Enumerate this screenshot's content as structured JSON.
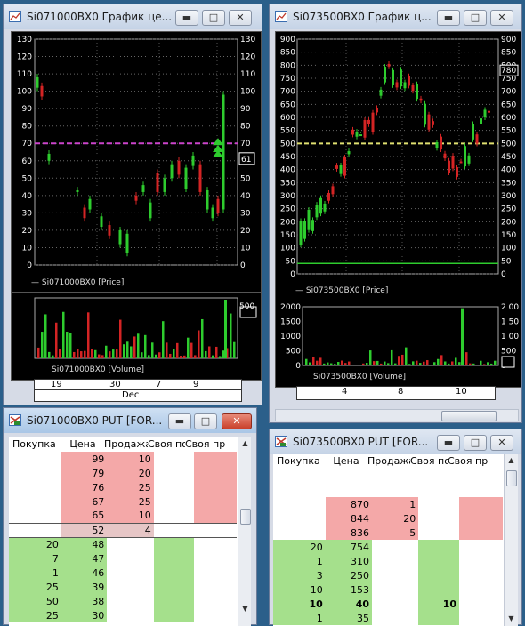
{
  "win1": {
    "title": "Si071000BX0 График це...",
    "price_chart": {
      "yticks": [
        "130",
        "120",
        "110",
        "100",
        "90",
        "80",
        "70",
        "60",
        "50",
        "40",
        "30",
        "20",
        "10",
        "0"
      ],
      "ymin": 0,
      "ymax": 130,
      "level_line": 70,
      "current_label": "61",
      "legend": "Si071000BX0 [Price]"
    },
    "volume_chart": {
      "right_tick": "500",
      "legend": "Si071000BX0 [Volume]"
    },
    "date_row1": [
      "19",
      "30",
      "7",
      "9"
    ],
    "date_row2": "Dec"
  },
  "win2": {
    "title": "Si073500BX0 График ц...",
    "price_chart": {
      "yticks": [
        "900",
        "850",
        "800",
        "750",
        "700",
        "650",
        "600",
        "550",
        "500",
        "450",
        "400",
        "350",
        "300",
        "250",
        "200",
        "150",
        "100",
        "50",
        "0"
      ],
      "ymin": 0,
      "ymax": 900,
      "level_line": 500,
      "green_line": 40,
      "current_label": "780",
      "legend": "Si073500BX0 [Price]"
    },
    "volume_chart": {
      "yticks": [
        "2000",
        "1500",
        "1000",
        "500",
        "0"
      ],
      "right_ticks": [
        "2 00",
        "1 50",
        "1 00",
        "500",
        "0"
      ],
      "legend": "Si073500BX0 [Volume]"
    },
    "date_row1": [
      "4",
      "8",
      "10"
    ]
  },
  "win3": {
    "title": "Si071000BX0 PUT [FOR...",
    "headers": [
      "Покупка",
      "Цена",
      "Продажа",
      "Своя по",
      "Своя пр"
    ],
    "rows": [
      {
        "buy": "",
        "price": "99",
        "sell": "10",
        "side": "ask"
      },
      {
        "buy": "",
        "price": "79",
        "sell": "20",
        "side": "ask"
      },
      {
        "buy": "",
        "price": "76",
        "sell": "25",
        "side": "ask"
      },
      {
        "buy": "",
        "price": "67",
        "sell": "25",
        "side": "ask"
      },
      {
        "buy": "",
        "price": "65",
        "sell": "10",
        "side": "ask"
      },
      {
        "buy": "",
        "price": "52",
        "sell": "4",
        "side": "last"
      },
      {
        "buy": "20",
        "price": "48",
        "sell": "",
        "side": "bid"
      },
      {
        "buy": "7",
        "price": "47",
        "sell": "",
        "side": "bid"
      },
      {
        "buy": "1",
        "price": "46",
        "sell": "",
        "side": "bid"
      },
      {
        "buy": "25",
        "price": "39",
        "sell": "",
        "side": "bid"
      },
      {
        "buy": "50",
        "price": "38",
        "sell": "",
        "side": "bid"
      },
      {
        "buy": "25",
        "price": "30",
        "sell": "",
        "side": "bid"
      }
    ]
  },
  "win4": {
    "title": "Si073500BX0 PUT [FOR...",
    "headers": [
      "Покупка",
      "Цена",
      "Продажа",
      "Своя по",
      "Своя пр"
    ],
    "rows": [
      {
        "buy": "",
        "price": "",
        "sell": "",
        "own_buy": "",
        "side": "empty"
      },
      {
        "buy": "",
        "price": "",
        "sell": "",
        "own_buy": "",
        "side": "empty"
      },
      {
        "buy": "",
        "price": "870",
        "sell": "1",
        "own_buy": "",
        "side": "ask"
      },
      {
        "buy": "",
        "price": "844",
        "sell": "20",
        "own_buy": "",
        "side": "ask"
      },
      {
        "buy": "",
        "price": "836",
        "sell": "5",
        "own_buy": "",
        "side": "ask"
      },
      {
        "buy": "20",
        "price": "754",
        "sell": "",
        "own_buy": "",
        "side": "bid"
      },
      {
        "buy": "1",
        "price": "310",
        "sell": "",
        "own_buy": "",
        "side": "bid"
      },
      {
        "buy": "3",
        "price": "250",
        "sell": "",
        "own_buy": "",
        "side": "bid"
      },
      {
        "buy": "10",
        "price": "153",
        "sell": "",
        "own_buy": "",
        "side": "bid"
      },
      {
        "buy": "10",
        "price": "40",
        "sell": "",
        "own_buy": "10",
        "side": "bid-bold"
      },
      {
        "buy": "1",
        "price": "35",
        "sell": "",
        "own_buy": "",
        "side": "bid"
      }
    ]
  },
  "colors": {
    "ask": "#f4a8a8",
    "bid": "#a5e08c",
    "up": "#2ecc2e",
    "down": "#d42424",
    "level": "#cc44cc",
    "level2": "#e0e070"
  },
  "icons": {
    "minimize": "minimize-icon",
    "maximize": "maximize-icon",
    "close": "close-icon"
  }
}
